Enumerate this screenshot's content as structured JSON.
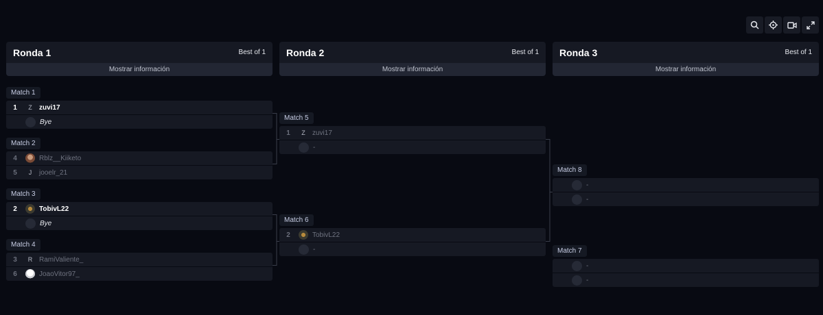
{
  "toolbar": {
    "buttons": [
      {
        "icon": "search-icon"
      },
      {
        "icon": "crosshair-icon"
      },
      {
        "icon": "video-icon"
      },
      {
        "icon": "expand-icon"
      }
    ]
  },
  "rounds": [
    {
      "title": "Ronda 1",
      "best_of": "Best of 1",
      "info": "Mostrar información"
    },
    {
      "title": "Ronda 2",
      "best_of": "Best of 1",
      "info": "Mostrar información"
    },
    {
      "title": "Ronda 3",
      "best_of": "Best of 1",
      "info": "Mostrar información"
    }
  ],
  "matches": {
    "m1": {
      "label": "Match 1",
      "teams": [
        {
          "seed": "1",
          "avatar": "Z",
          "name": "zuvi17",
          "winner": true
        },
        {
          "seed": "",
          "avatar": "",
          "name": "Bye"
        }
      ]
    },
    "m2": {
      "label": "Match 2",
      "teams": [
        {
          "seed": "4",
          "avatar": "",
          "name": "Rblz__Kiiketo"
        },
        {
          "seed": "5",
          "avatar": "J",
          "name": "jooelr_21"
        }
      ]
    },
    "m3": {
      "label": "Match 3",
      "teams": [
        {
          "seed": "2",
          "avatar": "",
          "name": "TobivL22",
          "winner": true
        },
        {
          "seed": "",
          "avatar": "",
          "name": "Bye"
        }
      ]
    },
    "m4": {
      "label": "Match 4",
      "teams": [
        {
          "seed": "3",
          "avatar": "R",
          "name": "RamiValiente_"
        },
        {
          "seed": "6",
          "avatar": "",
          "name": "JoaoVitor97_"
        }
      ]
    },
    "m5": {
      "label": "Match 5",
      "teams": [
        {
          "seed": "1",
          "avatar": "Z",
          "name": "zuvi17"
        },
        {
          "seed": "",
          "avatar": "",
          "name": "-"
        }
      ]
    },
    "m6": {
      "label": "Match 6",
      "teams": [
        {
          "seed": "2",
          "avatar": "",
          "name": "TobivL22"
        },
        {
          "seed": "",
          "avatar": "",
          "name": "-"
        }
      ]
    },
    "m8": {
      "label": "Match 8",
      "teams": [
        {
          "seed": "",
          "avatar": "",
          "name": "-"
        },
        {
          "seed": "",
          "avatar": "",
          "name": "-"
        }
      ]
    },
    "m7": {
      "label": "Match 7",
      "teams": [
        {
          "seed": "",
          "avatar": "",
          "name": "-"
        },
        {
          "seed": "",
          "avatar": "",
          "name": "-"
        }
      ]
    }
  }
}
